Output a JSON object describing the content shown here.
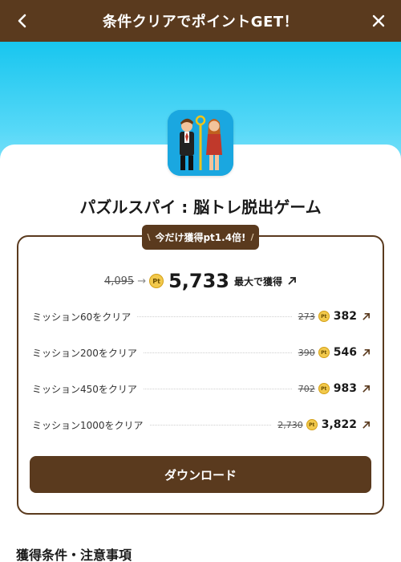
{
  "header": {
    "title": "条件クリアでポイントGET！"
  },
  "app": {
    "name": "パズルスパイ : 脳トレ脱出ゲーム"
  },
  "badge": {
    "text": "今だけ獲得pt1.4倍!"
  },
  "total": {
    "old_points": "4,095",
    "arrow": "→",
    "new_points": "5,733",
    "suffix": "最大で獲得",
    "pt_icon_label": "Pt"
  },
  "missions": [
    {
      "label": "ミッション60をクリア",
      "old_points": "273",
      "new_points": "382"
    },
    {
      "label": "ミッション200をクリア",
      "old_points": "390",
      "new_points": "546"
    },
    {
      "label": "ミッション450をクリア",
      "old_points": "702",
      "new_points": "983"
    },
    {
      "label": "ミッション1000をクリア",
      "old_points": "2,730",
      "new_points": "3,822"
    }
  ],
  "download_button": {
    "label": "ダウンロード"
  },
  "conditions": {
    "title": "獲得条件・注意事項"
  },
  "colors": {
    "brand_brown": "#5a3a1e",
    "hero_cyan": "#18c6ef",
    "coin_gold": "#f2c94c"
  },
  "icons": {
    "back": "chevron-left-icon",
    "close": "close-icon",
    "coin": "point-coin-icon",
    "external": "arrow-up-right-icon"
  }
}
